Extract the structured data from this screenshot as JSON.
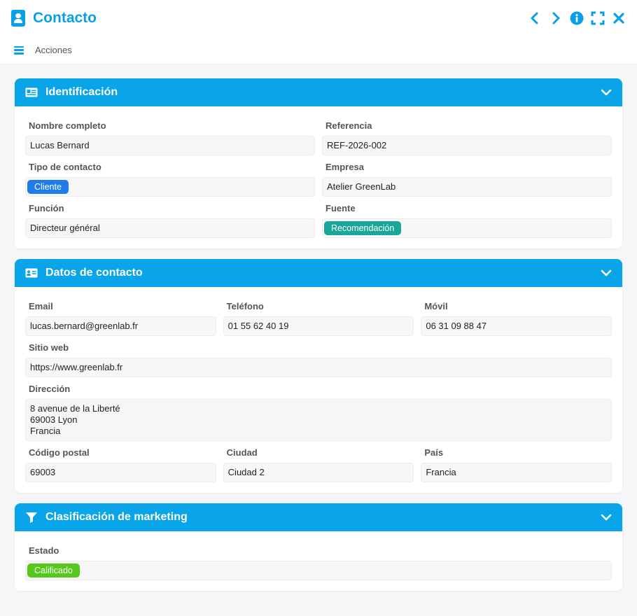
{
  "window": {
    "title": "Contacto",
    "controls": [
      "chevron-left-icon",
      "chevron-right-icon",
      "info-icon",
      "fullscreen-icon",
      "close-icon"
    ]
  },
  "toolbar": {
    "actions_label": "Acciones"
  },
  "colors": {
    "accent": "#0aa0e6",
    "header": "#0aa5e8",
    "badge_blue": "#1e7be8",
    "badge_teal": "#1aa79a",
    "badge_green": "#55c81c"
  },
  "identificacion": {
    "title": "Identificación",
    "nombre_label": "Nombre completo",
    "nombre_value": "Lucas Bernard",
    "referencia_label": "Referencia",
    "referencia_value": "REF-2026-002",
    "tipo_label": "Tipo de contacto",
    "tipo_value": "Cliente",
    "empresa_label": "Empresa",
    "empresa_value": "Atelier GreenLab",
    "funcion_label": "Función",
    "funcion_value": "Directeur général",
    "fuente_label": "Fuente",
    "fuente_value": "Recomendación"
  },
  "datos": {
    "title": "Datos de contacto",
    "email_label": "Email",
    "email_value": "lucas.bernard@greenlab.fr",
    "telefono_label": "Teléfono",
    "telefono_value": "01 55 62 40 19",
    "movil_label": "Móvil",
    "movil_value": "06 31 09 88 47",
    "web_label": "Sitio web",
    "web_value": "https://www.greenlab.fr",
    "direccion_label": "Dirección",
    "direccion_value": "8 avenue de la Liberté\n69003 Lyon\nFrancia",
    "cp_label": "Código postal",
    "cp_value": "69003",
    "ciudad_label": "Ciudad",
    "ciudad_value": "Ciudad 2",
    "pais_label": "País",
    "pais_value": "Francia"
  },
  "marketing": {
    "title": "Clasificación de marketing",
    "estado_label": "Estado",
    "estado_value": "Calificado"
  }
}
